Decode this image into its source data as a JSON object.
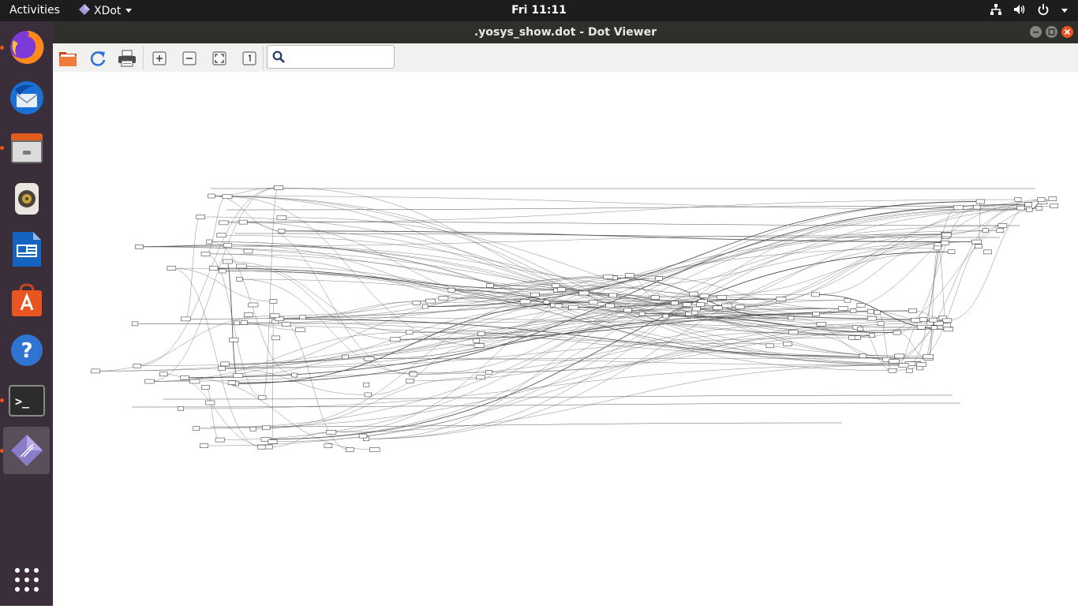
{
  "topbar": {
    "activities": "Activities",
    "app_name": "XDot",
    "clock": "Fri 11:11",
    "tray_icons": [
      "network-icon",
      "volume-icon",
      "power-icon",
      "tray-menu-arrow-icon"
    ]
  },
  "dock": {
    "items": [
      {
        "name": "firefox",
        "icon": "firefox-icon",
        "running": true
      },
      {
        "name": "thunderbird",
        "icon": "thunderbird-icon",
        "running": false
      },
      {
        "name": "files",
        "icon": "files-icon",
        "running": true
      },
      {
        "name": "rhythmbox",
        "icon": "rhythmbox-icon",
        "running": false
      },
      {
        "name": "libreoffice-writer",
        "icon": "writer-icon",
        "running": false
      },
      {
        "name": "software",
        "icon": "software-icon",
        "running": false
      },
      {
        "name": "help",
        "icon": "help-icon",
        "running": false
      },
      {
        "name": "terminal",
        "icon": "terminal-icon",
        "running": true
      },
      {
        "name": "xdot",
        "icon": "xdot-icon",
        "running": true,
        "active": true
      }
    ],
    "show_apps_icon": "app-grid-icon",
    "help_glyph": "?",
    "terminal_glyph": ">_"
  },
  "window": {
    "title": ".yosys_show.dot - Dot Viewer"
  },
  "toolbar": {
    "buttons": [
      "open-icon",
      "reload-icon",
      "print-icon",
      "zoom-in-icon",
      "zoom-out-icon",
      "zoom-fit-icon",
      "zoom-100-icon"
    ],
    "search_placeholder": "",
    "search_value": ""
  },
  "colors": {
    "topbar": "#1d1d1d",
    "dock": "#3a2e3a",
    "accent": "#e95420",
    "titlebar": "#302f2c",
    "toolbar": "#f2f1f0",
    "canvas": "#ffffff",
    "graph_edge": "#555555"
  },
  "graph": {
    "description_kind": "dense yosys netlist graph rendered by xdot",
    "labels_legible": false
  }
}
